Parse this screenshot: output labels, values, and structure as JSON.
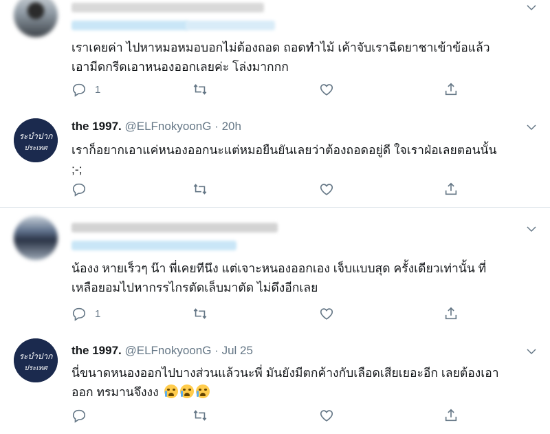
{
  "tweets": [
    {
      "id": "t1",
      "author_name": "",
      "handle": "",
      "time": "",
      "text_lines": [
        "เราเคยค่า ไปหาหมอหมอบอกไม่ต้องถอด ถอดทำไม้ เค้าจับเราฉีดยาชาเข้าข้อแล้ว",
        "เอามีดกรีดเอาหนองออกเลยค่ะ โล่งมากกก"
      ],
      "reply_count": "1",
      "retweet_count": "",
      "like_count": ""
    },
    {
      "id": "t2",
      "author_name": "the 1997.",
      "handle": "@ELFnokyoonG",
      "separator": "·",
      "time": "20h",
      "text_lines": [
        "เราก็อยากเอาแค่หนองออกนะแต่หมอยืนยันเลยว่าต้องถอดอยู่ดี ใจเราฝ่อเลยตอนนั้น",
        ";-;"
      ],
      "reply_count": "",
      "retweet_count": "",
      "like_count": ""
    },
    {
      "id": "t3",
      "author_name": "",
      "handle": "",
      "time": "",
      "text_lines": [
        "น้องง หายเร็วๆ น๊า พี่เคยทีนึง แต่เจาะหนองออกเอง เจ็บแบบสุด ครั้งเดียวเท่านั้น ที่",
        "เหลือยอมไปหากรรไกรตัดเล็บมาตัด ไม่ดึงอีกเลย"
      ],
      "reply_count": "1",
      "retweet_count": "",
      "like_count": ""
    },
    {
      "id": "t4",
      "author_name": "the 1997.",
      "handle": "@ELFnokyoonG",
      "separator": "·",
      "time": "Jul 25",
      "text_lines": [
        "นี่ขนาดหนองออกไปบางส่วนแล้วนะพี่ มันยังมีตกค้างกับเลือดเสียเยอะอีก เลยต้องเอา",
        "ออก ทรมานจึงงง"
      ],
      "emoji": [
        "loudly-crying-face",
        "loudly-crying-face",
        "loudly-crying-face"
      ],
      "reply_count": "",
      "retweet_count": "",
      "like_count": ""
    }
  ],
  "icons": {
    "reply": "reply-icon",
    "retweet": "retweet-icon",
    "like": "like-icon",
    "share": "share-icon",
    "more": "chevron-down-icon"
  },
  "colors": {
    "text": "#14171a",
    "secondary": "#657786",
    "divider": "#e1e8ed",
    "blur_blue": "#c9e6f7",
    "blur_gray": "#d7d7d7",
    "avatar_navy": "#1b2a4e"
  },
  "avatar_logo_lines": [
    "ระบำปาก",
    "ประเทศ"
  ]
}
